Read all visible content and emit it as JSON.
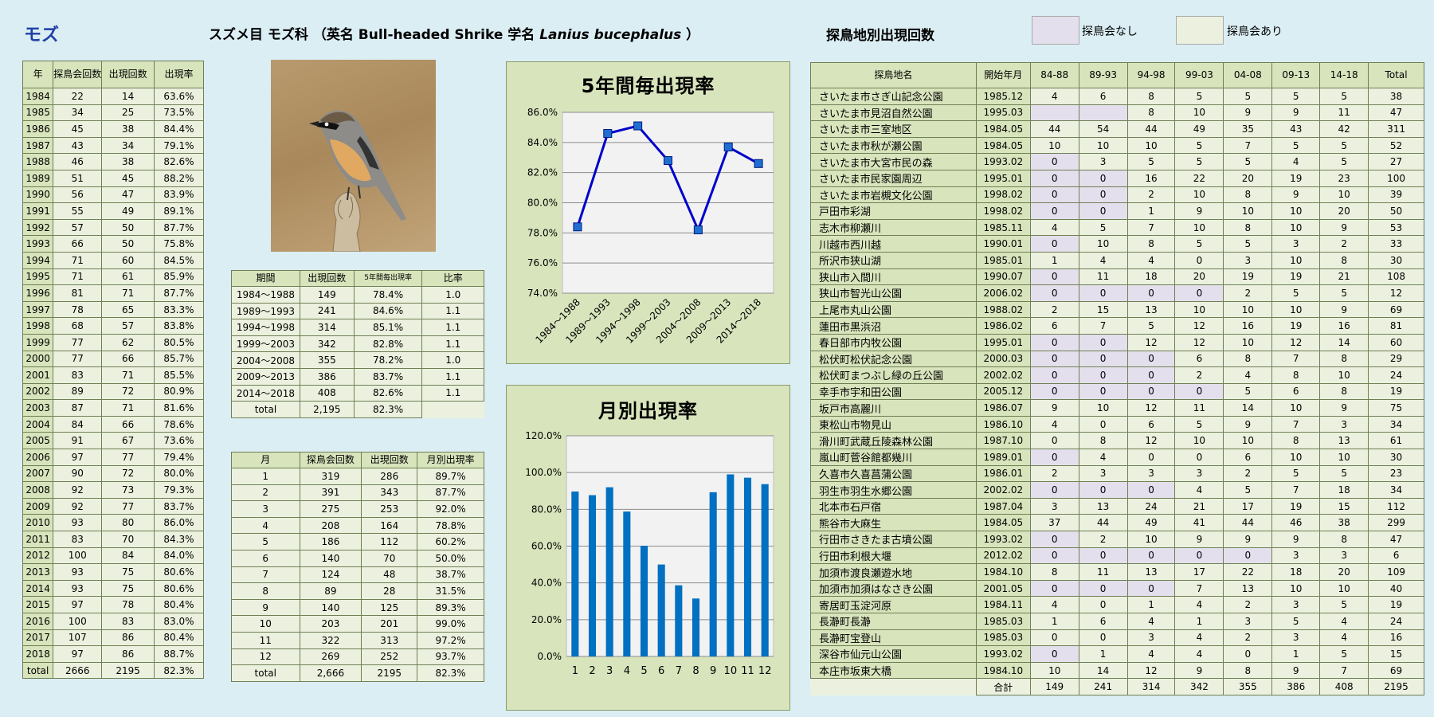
{
  "header": {
    "species": "モズ",
    "classification": "スズメ目 モズ科 （英名 Bull-headed Shrike 学名",
    "scientific_name": "Lanius bucephalus",
    "close_paren": "）",
    "sites_heading": "探鳥地別出現回数",
    "legend_none": "探鳥会なし",
    "legend_yes": "探鳥会あり",
    "color_none": "#e4dfec",
    "color_yes": "#ebf1de"
  },
  "yearly": {
    "headers": [
      "年",
      "探鳥会回数",
      "出現回数",
      "出現率"
    ],
    "rows": [
      [
        "1984",
        "22",
        "14",
        "63.6%"
      ],
      [
        "1985",
        "34",
        "25",
        "73.5%"
      ],
      [
        "1986",
        "45",
        "38",
        "84.4%"
      ],
      [
        "1987",
        "43",
        "34",
        "79.1%"
      ],
      [
        "1988",
        "46",
        "38",
        "82.6%"
      ],
      [
        "1989",
        "51",
        "45",
        "88.2%"
      ],
      [
        "1990",
        "56",
        "47",
        "83.9%"
      ],
      [
        "1991",
        "55",
        "49",
        "89.1%"
      ],
      [
        "1992",
        "57",
        "50",
        "87.7%"
      ],
      [
        "1993",
        "66",
        "50",
        "75.8%"
      ],
      [
        "1994",
        "71",
        "60",
        "84.5%"
      ],
      [
        "1995",
        "71",
        "61",
        "85.9%"
      ],
      [
        "1996",
        "81",
        "71",
        "87.7%"
      ],
      [
        "1997",
        "78",
        "65",
        "83.3%"
      ],
      [
        "1998",
        "68",
        "57",
        "83.8%"
      ],
      [
        "1999",
        "77",
        "62",
        "80.5%"
      ],
      [
        "2000",
        "77",
        "66",
        "85.7%"
      ],
      [
        "2001",
        "83",
        "71",
        "85.5%"
      ],
      [
        "2002",
        "89",
        "72",
        "80.9%"
      ],
      [
        "2003",
        "87",
        "71",
        "81.6%"
      ],
      [
        "2004",
        "84",
        "66",
        "78.6%"
      ],
      [
        "2005",
        "91",
        "67",
        "73.6%"
      ],
      [
        "2006",
        "97",
        "77",
        "79.4%"
      ],
      [
        "2007",
        "90",
        "72",
        "80.0%"
      ],
      [
        "2008",
        "92",
        "73",
        "79.3%"
      ],
      [
        "2009",
        "92",
        "77",
        "83.7%"
      ],
      [
        "2010",
        "93",
        "80",
        "86.0%"
      ],
      [
        "2011",
        "83",
        "70",
        "84.3%"
      ],
      [
        "2012",
        "100",
        "84",
        "84.0%"
      ],
      [
        "2013",
        "93",
        "75",
        "80.6%"
      ],
      [
        "2014",
        "93",
        "75",
        "80.6%"
      ],
      [
        "2015",
        "97",
        "78",
        "80.4%"
      ],
      [
        "2016",
        "100",
        "83",
        "83.0%"
      ],
      [
        "2017",
        "107",
        "86",
        "80.4%"
      ],
      [
        "2018",
        "97",
        "86",
        "88.7%"
      ],
      [
        "total",
        "2666",
        "2195",
        "82.3%"
      ]
    ]
  },
  "period": {
    "headers": [
      "期間",
      "出現回数",
      "5年間毎出現率",
      "比率"
    ],
    "rows": [
      [
        "1984～1988",
        "149",
        "78.4%",
        "1.0"
      ],
      [
        "1989～1993",
        "241",
        "84.6%",
        "1.1"
      ],
      [
        "1994～1998",
        "314",
        "85.1%",
        "1.1"
      ],
      [
        "1999～2003",
        "342",
        "82.8%",
        "1.1"
      ],
      [
        "2004～2008",
        "355",
        "78.2%",
        "1.0"
      ],
      [
        "2009～2013",
        "386",
        "83.7%",
        "1.1"
      ],
      [
        "2014～2018",
        "408",
        "82.6%",
        "1.1"
      ]
    ],
    "total": [
      "total",
      "2,195",
      "82.3%"
    ]
  },
  "monthly": {
    "headers": [
      "月",
      "探鳥会回数",
      "出現回数",
      "月別出現率"
    ],
    "rows": [
      [
        "1",
        "319",
        "286",
        "89.7%"
      ],
      [
        "2",
        "391",
        "343",
        "87.7%"
      ],
      [
        "3",
        "275",
        "253",
        "92.0%"
      ],
      [
        "4",
        "208",
        "164",
        "78.8%"
      ],
      [
        "5",
        "186",
        "112",
        "60.2%"
      ],
      [
        "6",
        "140",
        "70",
        "50.0%"
      ],
      [
        "7",
        "124",
        "48",
        "38.7%"
      ],
      [
        "8",
        "89",
        "28",
        "31.5%"
      ],
      [
        "9",
        "140",
        "125",
        "89.3%"
      ],
      [
        "10",
        "203",
        "201",
        "99.0%"
      ],
      [
        "11",
        "322",
        "313",
        "97.2%"
      ],
      [
        "12",
        "269",
        "252",
        "93.7%"
      ],
      [
        "total",
        "2,666",
        "2195",
        "82.3%"
      ]
    ]
  },
  "sites": {
    "headers": [
      "探鳥地名",
      "開始年月",
      "84-88",
      "89-93",
      "94-98",
      "99-03",
      "04-08",
      "09-13",
      "14-18",
      "Total"
    ],
    "rows": [
      {
        "name": "さいたま市さぎ山記念公園",
        "start": "1985.12",
        "v": [
          "4",
          "6",
          "8",
          "5",
          "5",
          "5",
          "5"
        ],
        "t": "38",
        "p": []
      },
      {
        "name": "さいたま市見沼自然公園",
        "start": "1995.03",
        "v": [
          "",
          "",
          "8",
          "10",
          "9",
          "9",
          "11"
        ],
        "t": "47",
        "p": [
          0,
          1
        ]
      },
      {
        "name": "さいたま市三室地区",
        "start": "1984.05",
        "v": [
          "44",
          "54",
          "44",
          "49",
          "35",
          "43",
          "42"
        ],
        "t": "311",
        "p": []
      },
      {
        "name": "さいたま市秋が瀬公園",
        "start": "1984.05",
        "v": [
          "10",
          "10",
          "10",
          "5",
          "7",
          "5",
          "5"
        ],
        "t": "52",
        "p": []
      },
      {
        "name": "さいたま市大宮市民の森",
        "start": "1993.02",
        "v": [
          "0",
          "3",
          "5",
          "5",
          "5",
          "4",
          "5"
        ],
        "t": "27",
        "p": [
          0
        ]
      },
      {
        "name": "さいたま市民家園周辺",
        "start": "1995.01",
        "v": [
          "0",
          "0",
          "16",
          "22",
          "20",
          "19",
          "23"
        ],
        "t": "100",
        "p": [
          0,
          1
        ]
      },
      {
        "name": "さいたま市岩槻文化公園",
        "start": "1998.02",
        "v": [
          "0",
          "0",
          "2",
          "10",
          "8",
          "9",
          "10"
        ],
        "t": "39",
        "p": [
          0,
          1
        ]
      },
      {
        "name": "戸田市彩湖",
        "start": "1998.02",
        "v": [
          "0",
          "0",
          "1",
          "9",
          "10",
          "10",
          "20"
        ],
        "t": "50",
        "p": [
          0,
          1
        ]
      },
      {
        "name": "志木市柳瀬川",
        "start": "1985.11",
        "v": [
          "4",
          "5",
          "7",
          "10",
          "8",
          "10",
          "9"
        ],
        "t": "53",
        "p": []
      },
      {
        "name": "川越市西川越",
        "start": "1990.01",
        "v": [
          "0",
          "10",
          "8",
          "5",
          "5",
          "3",
          "2"
        ],
        "t": "33",
        "p": [
          0
        ]
      },
      {
        "name": "所沢市狭山湖",
        "start": "1985.01",
        "v": [
          "1",
          "4",
          "4",
          "0",
          "3",
          "10",
          "8"
        ],
        "t": "30",
        "p": []
      },
      {
        "name": "狭山市入間川",
        "start": "1990.07",
        "v": [
          "0",
          "11",
          "18",
          "20",
          "19",
          "19",
          "21"
        ],
        "t": "108",
        "p": [
          0
        ]
      },
      {
        "name": "狭山市智光山公園",
        "start": "2006.02",
        "v": [
          "0",
          "0",
          "0",
          "0",
          "2",
          "5",
          "5"
        ],
        "t": "12",
        "p": [
          0,
          1,
          2,
          3
        ]
      },
      {
        "name": "上尾市丸山公園",
        "start": "1988.02",
        "v": [
          "2",
          "15",
          "13",
          "10",
          "10",
          "10",
          "9"
        ],
        "t": "69",
        "p": []
      },
      {
        "name": "蓮田市黒浜沼",
        "start": "1986.02",
        "v": [
          "6",
          "7",
          "5",
          "12",
          "16",
          "19",
          "16"
        ],
        "t": "81",
        "p": []
      },
      {
        "name": "春日部市内牧公園",
        "start": "1995.01",
        "v": [
          "0",
          "0",
          "12",
          "12",
          "10",
          "12",
          "14"
        ],
        "t": "60",
        "p": [
          0,
          1
        ]
      },
      {
        "name": "松伏町松伏記念公園",
        "start": "2000.03",
        "v": [
          "0",
          "0",
          "0",
          "6",
          "8",
          "7",
          "8"
        ],
        "t": "29",
        "p": [
          0,
          1,
          2
        ]
      },
      {
        "name": "松伏町まつぶし緑の丘公園",
        "start": "2002.02",
        "v": [
          "0",
          "0",
          "0",
          "2",
          "4",
          "8",
          "10"
        ],
        "t": "24",
        "p": [
          0,
          1,
          2
        ]
      },
      {
        "name": "幸手市宇和田公園",
        "start": "2005.12",
        "v": [
          "0",
          "0",
          "0",
          "0",
          "5",
          "6",
          "8"
        ],
        "t": "19",
        "p": [
          0,
          1,
          2,
          3
        ]
      },
      {
        "name": "坂戸市高麗川",
        "start": "1986.07",
        "v": [
          "9",
          "10",
          "12",
          "11",
          "14",
          "10",
          "9"
        ],
        "t": "75",
        "p": []
      },
      {
        "name": "東松山市物見山",
        "start": "1986.10",
        "v": [
          "4",
          "0",
          "6",
          "5",
          "9",
          "7",
          "3"
        ],
        "t": "34",
        "p": []
      },
      {
        "name": "滑川町武蔵丘陵森林公園",
        "start": "1987.10",
        "v": [
          "0",
          "8",
          "12",
          "10",
          "10",
          "8",
          "13"
        ],
        "t": "61",
        "p": []
      },
      {
        "name": "嵐山町菅谷館都幾川",
        "start": "1989.01",
        "v": [
          "0",
          "4",
          "0",
          "0",
          "6",
          "10",
          "10"
        ],
        "t": "30",
        "p": [
          0
        ]
      },
      {
        "name": "久喜市久喜菖蒲公園",
        "start": "1986.01",
        "v": [
          "2",
          "3",
          "3",
          "3",
          "2",
          "5",
          "5"
        ],
        "t": "23",
        "p": []
      },
      {
        "name": "羽生市羽生水郷公園",
        "start": "2002.02",
        "v": [
          "0",
          "0",
          "0",
          "4",
          "5",
          "7",
          "18"
        ],
        "t": "34",
        "p": [
          0,
          1,
          2
        ]
      },
      {
        "name": "北本市石戸宿",
        "start": "1987.04",
        "v": [
          "3",
          "13",
          "24",
          "21",
          "17",
          "19",
          "15"
        ],
        "t": "112",
        "p": []
      },
      {
        "name": "熊谷市大麻生",
        "start": "1984.05",
        "v": [
          "37",
          "44",
          "49",
          "41",
          "44",
          "46",
          "38"
        ],
        "t": "299",
        "p": []
      },
      {
        "name": "行田市さきたま古墳公園",
        "start": "1993.02",
        "v": [
          "0",
          "2",
          "10",
          "9",
          "9",
          "9",
          "8"
        ],
        "t": "47",
        "p": [
          0
        ]
      },
      {
        "name": "行田市利根大堰",
        "start": "2012.02",
        "v": [
          "0",
          "0",
          "0",
          "0",
          "0",
          "3",
          "3"
        ],
        "t": "6",
        "p": [
          0,
          1,
          2,
          3,
          4
        ]
      },
      {
        "name": "加須市渡良瀬遊水地",
        "start": "1984.10",
        "v": [
          "8",
          "11",
          "13",
          "17",
          "22",
          "18",
          "20"
        ],
        "t": "109",
        "p": []
      },
      {
        "name": "加須市加須はなさき公園",
        "start": "2001.05",
        "v": [
          "0",
          "0",
          "0",
          "7",
          "13",
          "10",
          "10"
        ],
        "t": "40",
        "p": [
          0,
          1,
          2
        ]
      },
      {
        "name": "寄居町玉淀河原",
        "start": "1984.11",
        "v": [
          "4",
          "0",
          "1",
          "4",
          "2",
          "3",
          "5"
        ],
        "t": "19",
        "p": []
      },
      {
        "name": "長瀞町長瀞",
        "start": "1985.03",
        "v": [
          "1",
          "6",
          "4",
          "1",
          "3",
          "5",
          "4"
        ],
        "t": "24",
        "p": []
      },
      {
        "name": "長瀞町宝登山",
        "start": "1985.03",
        "v": [
          "0",
          "0",
          "3",
          "4",
          "2",
          "3",
          "4"
        ],
        "t": "16",
        "p": []
      },
      {
        "name": "深谷市仙元山公園",
        "start": "1993.02",
        "v": [
          "0",
          "1",
          "4",
          "4",
          "0",
          "1",
          "5"
        ],
        "t": "15",
        "p": [
          0
        ]
      },
      {
        "name": "本庄市坂東大橋",
        "start": "1984.10",
        "v": [
          "10",
          "14",
          "12",
          "9",
          "8",
          "9",
          "7"
        ],
        "t": "69",
        "p": []
      }
    ],
    "total_label": "合計",
    "totals": [
      "149",
      "241",
      "314",
      "342",
      "355",
      "386",
      "408",
      "2195"
    ]
  },
  "chart_data": [
    {
      "type": "line",
      "title": "5年間毎出現率",
      "categories": [
        "1984～1988",
        "1989～1993",
        "1994～1998",
        "1999～2003",
        "2004～2008",
        "2009～2013",
        "2014～2018"
      ],
      "values": [
        78.4,
        84.6,
        85.1,
        82.8,
        78.2,
        83.7,
        82.6
      ],
      "ylim": [
        74,
        86
      ],
      "yticks": [
        "74.0%",
        "76.0%",
        "78.0%",
        "80.0%",
        "82.0%",
        "84.0%",
        "86.0%"
      ],
      "color": "#0000cc",
      "grid": true
    },
    {
      "type": "bar",
      "title": "月別出現率",
      "categories": [
        "1",
        "2",
        "3",
        "4",
        "5",
        "6",
        "7",
        "8",
        "9",
        "10",
        "11",
        "12"
      ],
      "values": [
        89.7,
        87.7,
        92.0,
        78.8,
        60.2,
        50.0,
        38.7,
        31.5,
        89.3,
        99.0,
        97.2,
        93.7
      ],
      "ylim": [
        0,
        120
      ],
      "yticks": [
        "0.0%",
        "20.0%",
        "40.0%",
        "60.0%",
        "80.0%",
        "100.0%",
        "120.0%"
      ],
      "color": "#0070c0",
      "grid": true
    }
  ]
}
